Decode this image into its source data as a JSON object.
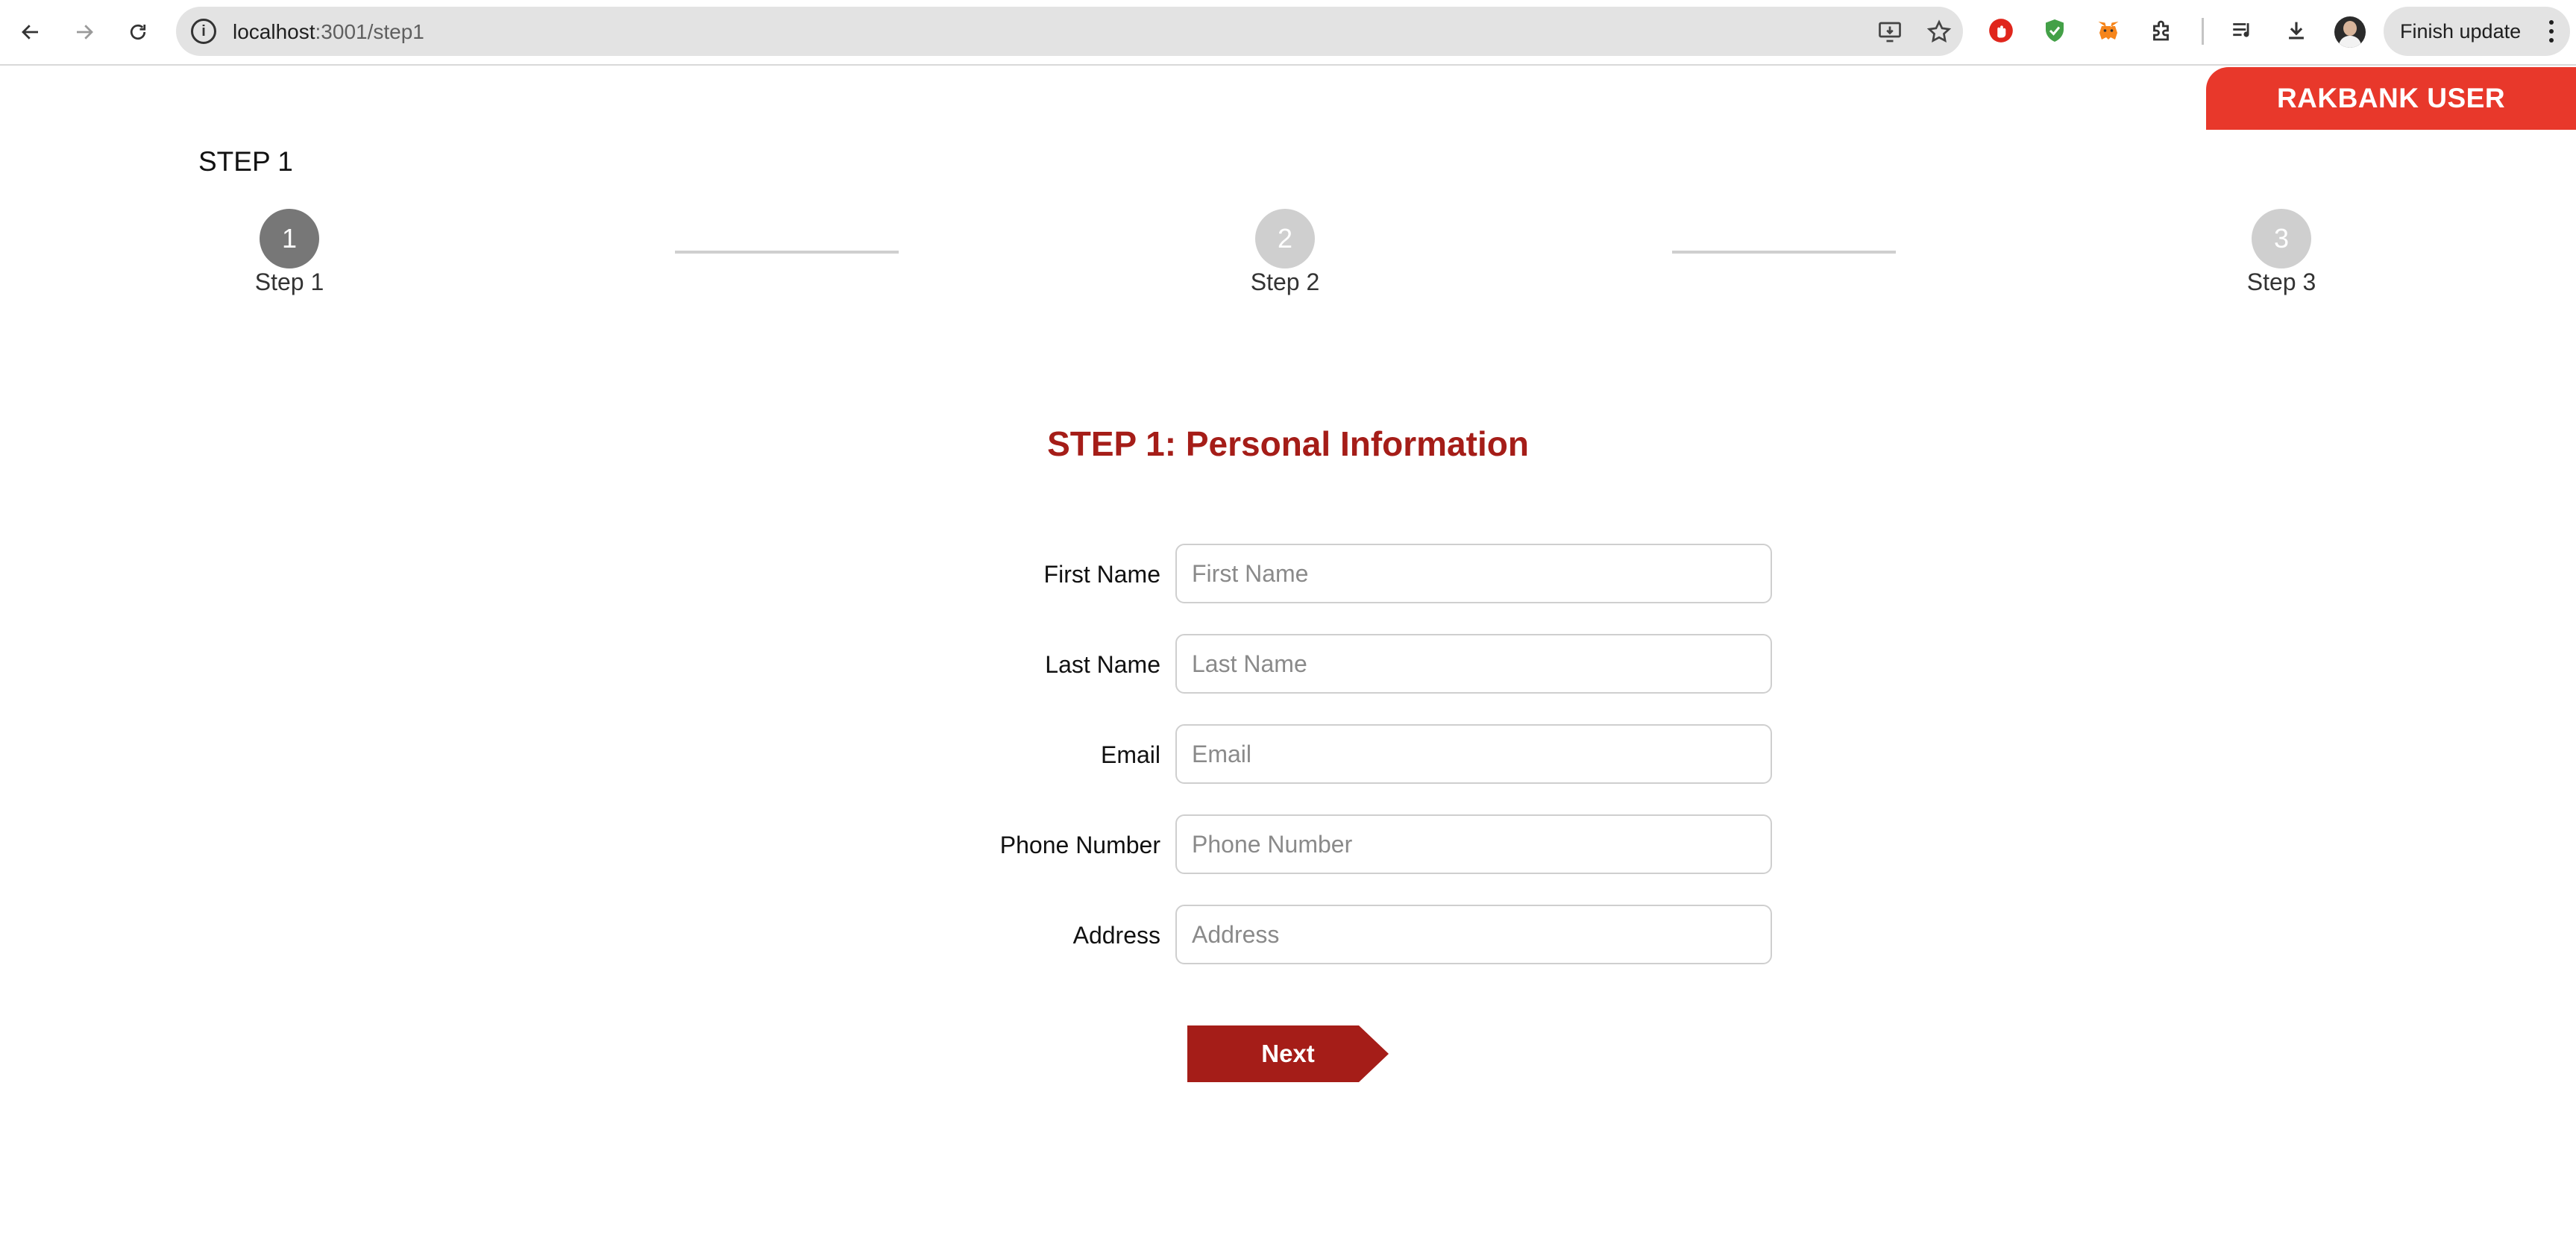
{
  "browser": {
    "url_host": "localhost",
    "url_path": ":3001/step1",
    "finish_update_label": "Finish update"
  },
  "header": {
    "user_badge": "RAKBANK USER"
  },
  "page": {
    "step_title": "STEP 1"
  },
  "stepper": {
    "steps": [
      {
        "number": "1",
        "label": "Step 1",
        "state": "active"
      },
      {
        "number": "2",
        "label": "Step 2",
        "state": "inactive"
      },
      {
        "number": "3",
        "label": "Step 3",
        "state": "inactive"
      }
    ]
  },
  "form": {
    "title": "STEP 1: Personal Information",
    "fields": [
      {
        "label": "First Name",
        "placeholder": "First Name",
        "value": ""
      },
      {
        "label": "Last Name",
        "placeholder": "Last Name",
        "value": ""
      },
      {
        "label": "Email",
        "placeholder": "Email",
        "value": ""
      },
      {
        "label": "Phone Number",
        "placeholder": "Phone Number",
        "value": ""
      },
      {
        "label": "Address",
        "placeholder": "Address",
        "value": ""
      }
    ],
    "next_label": "Next"
  },
  "colors": {
    "brand_red": "#a51d18",
    "badge_red": "#e8382b",
    "step_active": "#777777",
    "step_inactive": "#cfcfcf"
  }
}
